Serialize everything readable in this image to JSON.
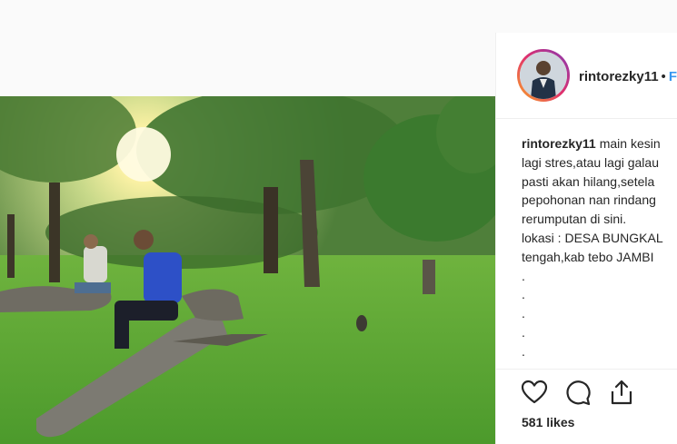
{
  "post": {
    "username": "rintorezky11",
    "header_separator": "•",
    "header_follow": "F",
    "caption": {
      "username": "rintorezky11",
      "lines": [
        "main kesin",
        "lagi stres,atau lagi galau",
        "pasti akan hilang,setela",
        "pepohonan nan rindang",
        "rerumputan di sini.",
        "lokasi : DESA BUNGKAL",
        "tengah,kab tebo JAMBI",
        ".",
        ".",
        ".",
        ".",
        "."
      ]
    },
    "likes": "581 likes"
  },
  "icons": {
    "like": "heart-icon",
    "comment": "comment-icon",
    "share": "share-icon"
  }
}
